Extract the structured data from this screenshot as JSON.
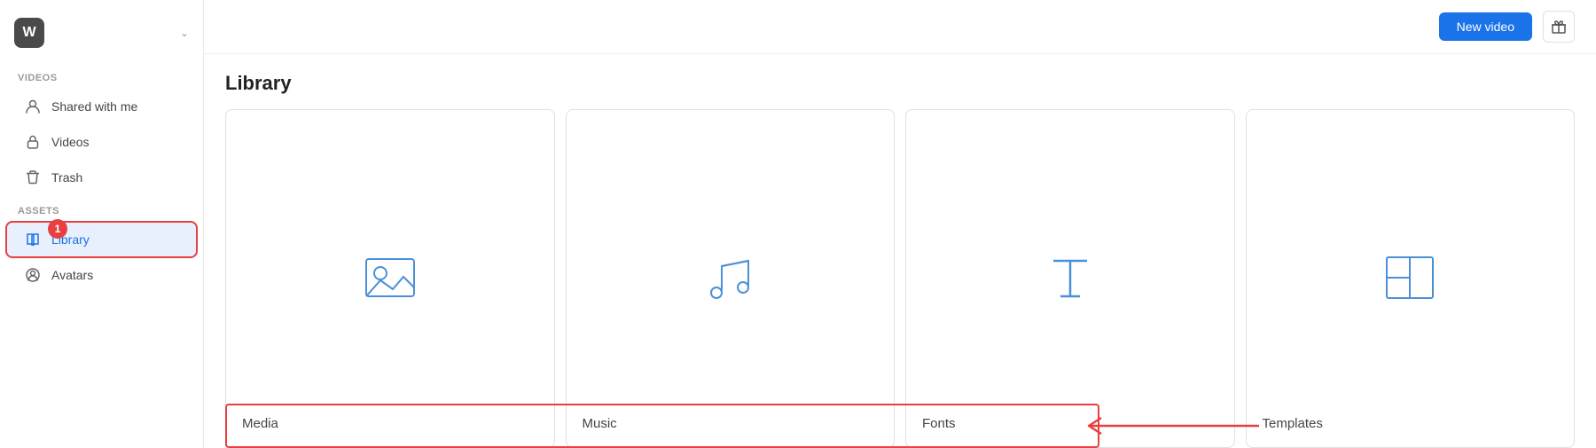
{
  "sidebar": {
    "logo": "W",
    "sections": [
      {
        "label": "Videos",
        "items": [
          {
            "id": "shared",
            "label": "Shared with me",
            "icon": "person-icon"
          },
          {
            "id": "videos",
            "label": "Videos",
            "icon": "lock-icon"
          },
          {
            "id": "trash",
            "label": "Trash",
            "icon": "trash-icon"
          }
        ]
      },
      {
        "label": "Assets",
        "items": [
          {
            "id": "library",
            "label": "Library",
            "icon": "book-icon",
            "active": true,
            "badge": 1
          },
          {
            "id": "avatars",
            "label": "Avatars",
            "icon": "avatar-icon"
          }
        ]
      }
    ]
  },
  "header": {
    "new_video_label": "New video"
  },
  "main": {
    "title": "Library",
    "cards": [
      {
        "id": "media",
        "label": "Media"
      },
      {
        "id": "music",
        "label": "Music"
      },
      {
        "id": "fonts",
        "label": "Fonts"
      },
      {
        "id": "templates",
        "label": "Templates"
      }
    ]
  },
  "annotation": {
    "badge_number": "1"
  }
}
